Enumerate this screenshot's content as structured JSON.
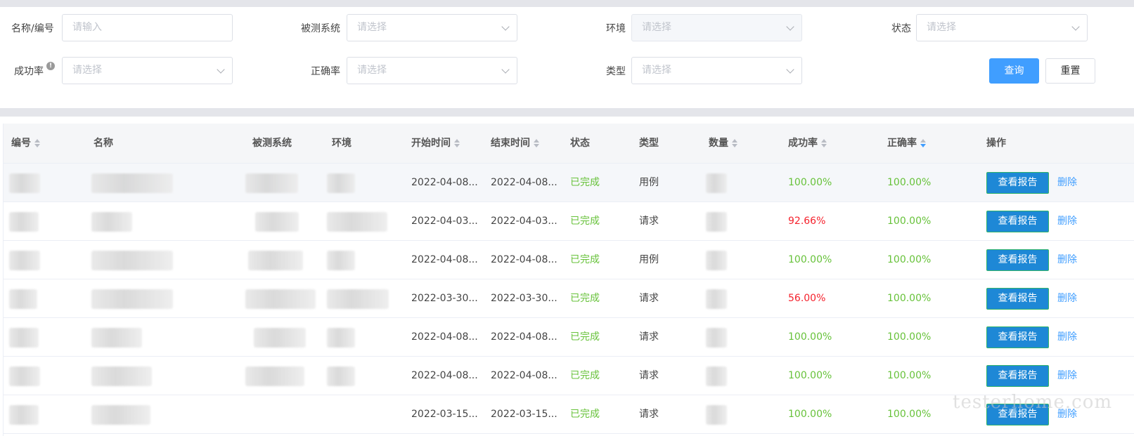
{
  "filters": {
    "name_label": "名称/编号",
    "name_placeholder": "请输入",
    "system_label": "被测系统",
    "system_placeholder": "请选择",
    "env_label": "环境",
    "env_placeholder": "请选择",
    "status_label": "状态",
    "status_placeholder": "请选择",
    "success_label": "成功率",
    "success_placeholder": "请选择",
    "accuracy_label": "正确率",
    "accuracy_placeholder": "请选择",
    "type_label": "类型",
    "type_placeholder": "请选择",
    "query_button": "查询",
    "reset_button": "重置"
  },
  "table": {
    "headers": {
      "id": "编号",
      "name": "名称",
      "system": "被测系统",
      "env": "环境",
      "start": "开始时间",
      "end": "结束时间",
      "status": "状态",
      "type": "类型",
      "count": "数量",
      "success": "成功率",
      "accuracy": "正确率",
      "actions": "操作"
    },
    "report_label": "查看报告",
    "delete_label": "删除",
    "rows": [
      {
        "start": "2022-04-08...",
        "end": "2022-04-08...",
        "status": "已完成",
        "type": "用例",
        "success": "100.00%",
        "success_ok": true,
        "accuracy": "100.00%"
      },
      {
        "start": "2022-04-03...",
        "end": "2022-04-03...",
        "status": "已完成",
        "type": "请求",
        "success": "92.66%",
        "success_ok": false,
        "accuracy": "100.00%"
      },
      {
        "start": "2022-04-08...",
        "end": "2022-04-08...",
        "status": "已完成",
        "type": "用例",
        "success": "100.00%",
        "success_ok": true,
        "accuracy": "100.00%"
      },
      {
        "start": "2022-03-30...",
        "end": "2022-03-30...",
        "status": "已完成",
        "type": "请求",
        "success": "56.00%",
        "success_ok": false,
        "accuracy": "100.00%"
      },
      {
        "start": "2022-04-08...",
        "end": "2022-04-08...",
        "status": "已完成",
        "type": "请求",
        "success": "100.00%",
        "success_ok": true,
        "accuracy": "100.00%"
      },
      {
        "start": "2022-04-08...",
        "end": "2022-04-08...",
        "status": "已完成",
        "type": "请求",
        "success": "100.00%",
        "success_ok": true,
        "accuracy": "100.00%"
      },
      {
        "start": "2022-03-15...",
        "end": "2022-03-15...",
        "status": "已完成",
        "type": "请求",
        "success": "100.00%",
        "success_ok": true,
        "accuracy": "100.00%"
      }
    ]
  },
  "watermark": "testerhome.com",
  "colors": {
    "primary": "#409eff",
    "success": "#67c23a",
    "danger": "#f5222d",
    "report_button": "#1e88d6"
  }
}
